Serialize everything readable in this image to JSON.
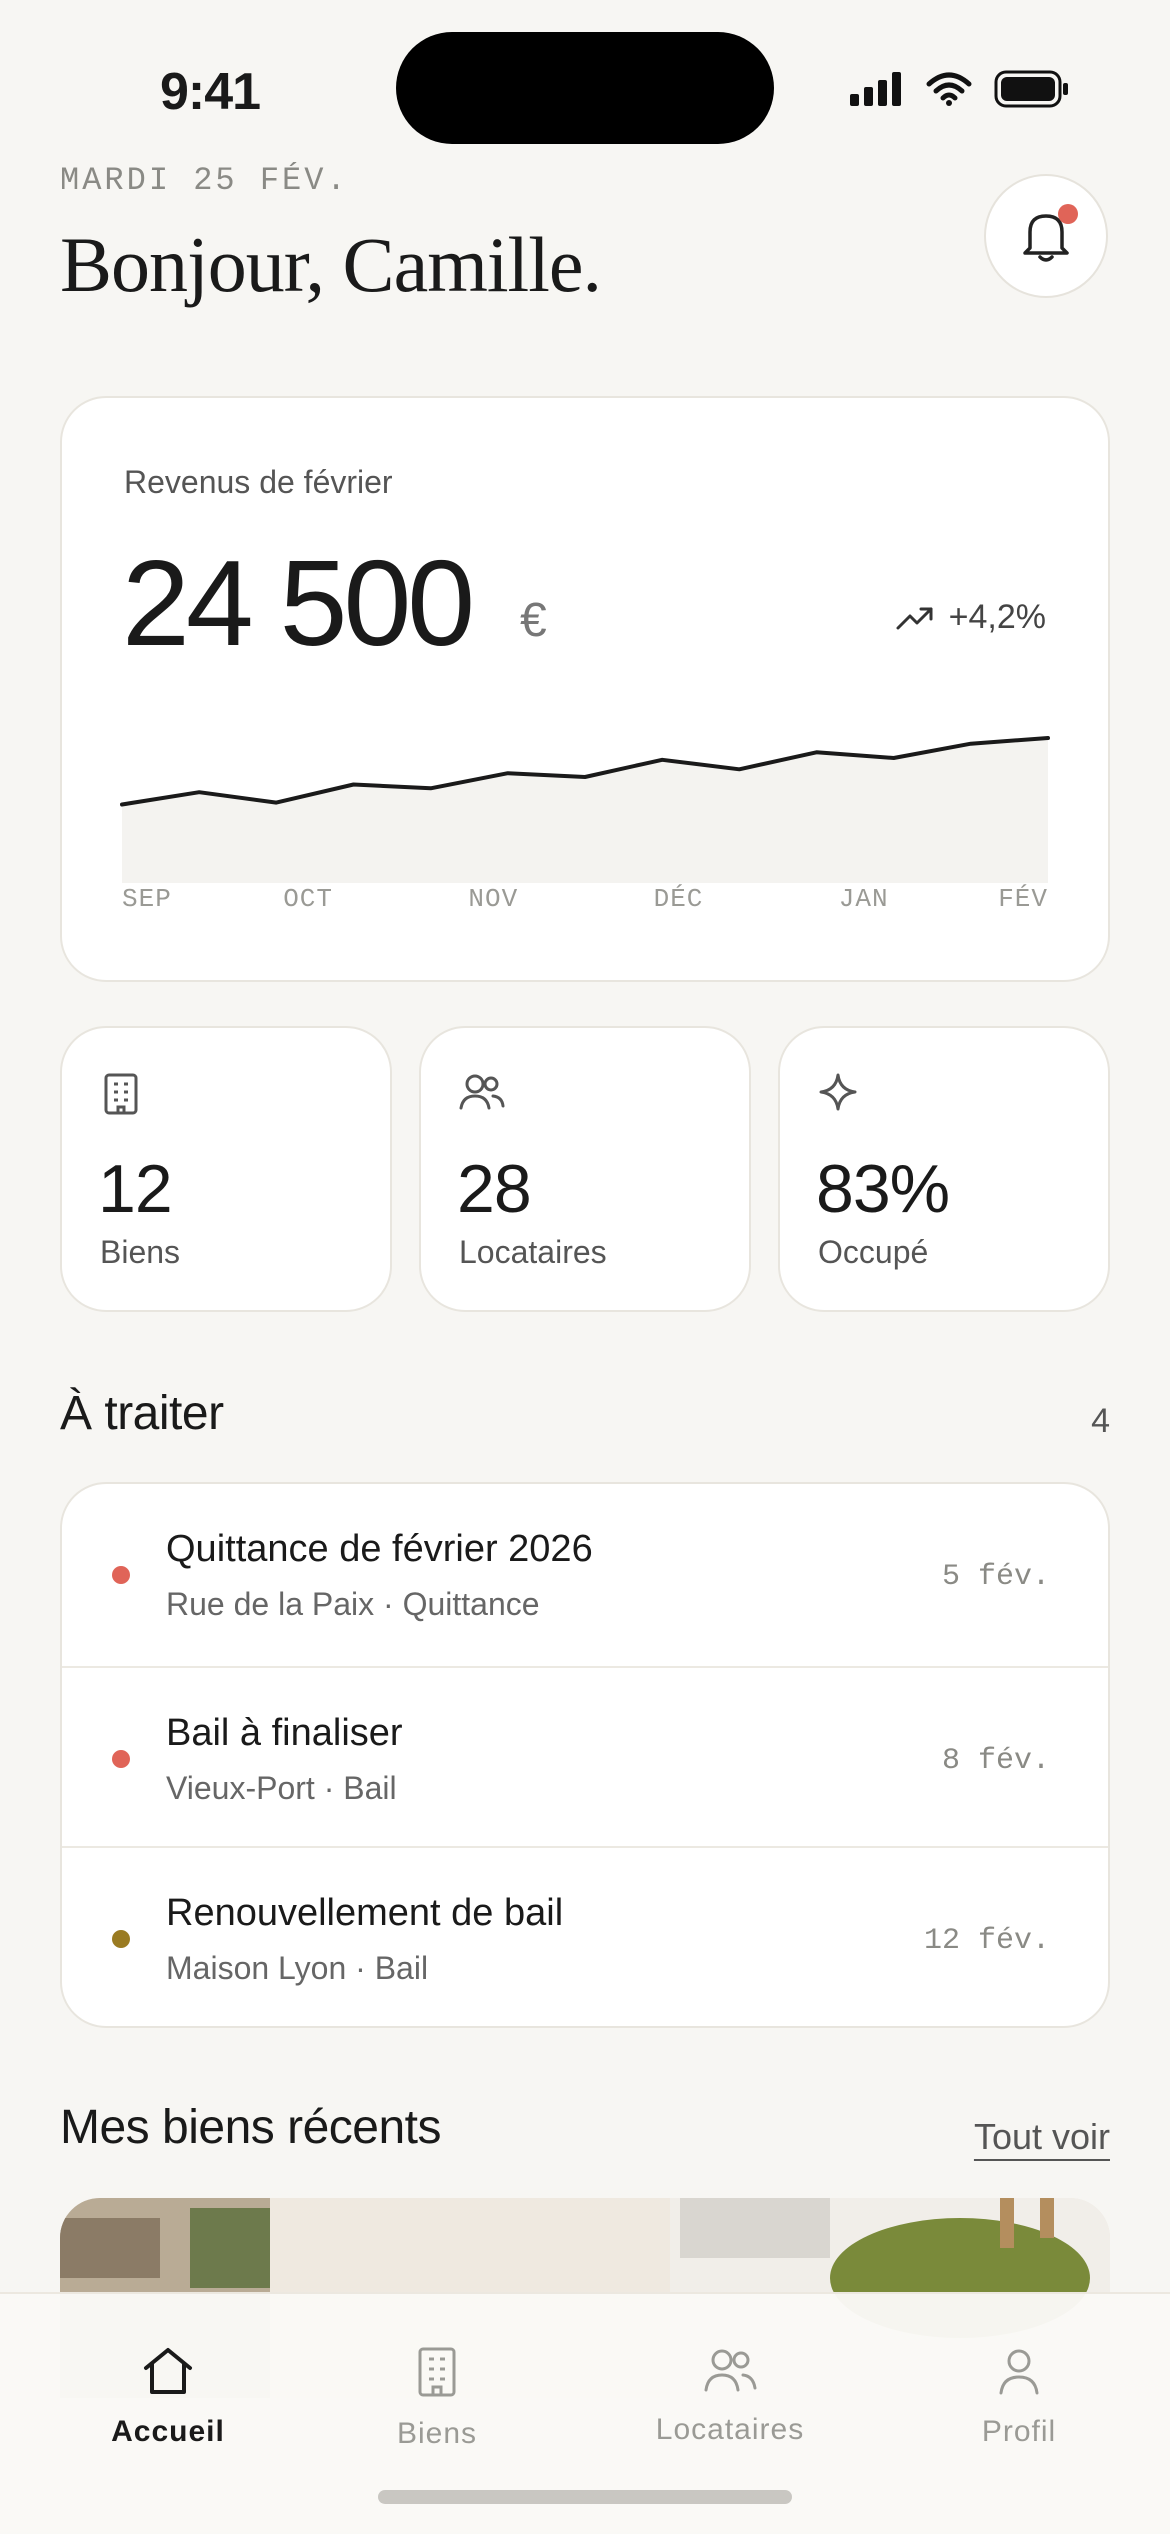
{
  "status_bar": {
    "time": "9:41"
  },
  "header": {
    "date": "MARDI 25 FÉV.",
    "greeting": "Bonjour, Camille."
  },
  "revenue": {
    "label": "Revenus de février",
    "amount": "24 500",
    "currency": "€",
    "delta": "+4,2%",
    "months": [
      "SEP",
      "OCT",
      "NOV",
      "DÉC",
      "JAN",
      "FÉV"
    ]
  },
  "chart_data": {
    "type": "area",
    "title": "Revenus de février",
    "x": [
      "SEP",
      "",
      "OCT",
      "",
      "NOV",
      "",
      "DÉC",
      "",
      "JAN",
      "",
      "FÉV",
      ""
    ],
    "values": [
      0.3,
      0.43,
      0.32,
      0.51,
      0.47,
      0.63,
      0.59,
      0.77,
      0.67,
      0.85,
      0.79,
      0.94,
      1.0
    ],
    "grid": false,
    "colors": {
      "line": "#1a1a1a",
      "fill": "#f4f3f0"
    }
  },
  "stats": [
    {
      "value": "12",
      "label": "Biens",
      "icon": "building-icon"
    },
    {
      "value": "28",
      "label": "Locataires",
      "icon": "users-icon"
    },
    {
      "value": "83%",
      "label": "Occupé",
      "icon": "sparkle-icon"
    }
  ],
  "todo": {
    "title": "À traiter",
    "count": "4",
    "items": [
      {
        "title": "Quittance de février 2026",
        "subtitle": "Rue de la Paix · Quittance",
        "date": "5 fév.",
        "color": "#e06458"
      },
      {
        "title": "Bail à finaliser",
        "subtitle": "Vieux-Port · Bail",
        "date": "8 fév.",
        "color": "#e06458"
      },
      {
        "title": "Renouvellement de bail",
        "subtitle": "Maison Lyon · Bail",
        "date": "12 fév.",
        "color": "#9a7b22"
      }
    ]
  },
  "recent": {
    "title": "Mes biens récents",
    "see_all": "Tout voir"
  },
  "tabbar": {
    "items": [
      {
        "label": "Accueil",
        "icon": "home-icon",
        "active": true
      },
      {
        "label": "Biens",
        "icon": "building-icon",
        "active": false
      },
      {
        "label": "Locataires",
        "icon": "users-icon",
        "active": false
      },
      {
        "label": "Profil",
        "icon": "person-icon",
        "active": false
      }
    ]
  }
}
